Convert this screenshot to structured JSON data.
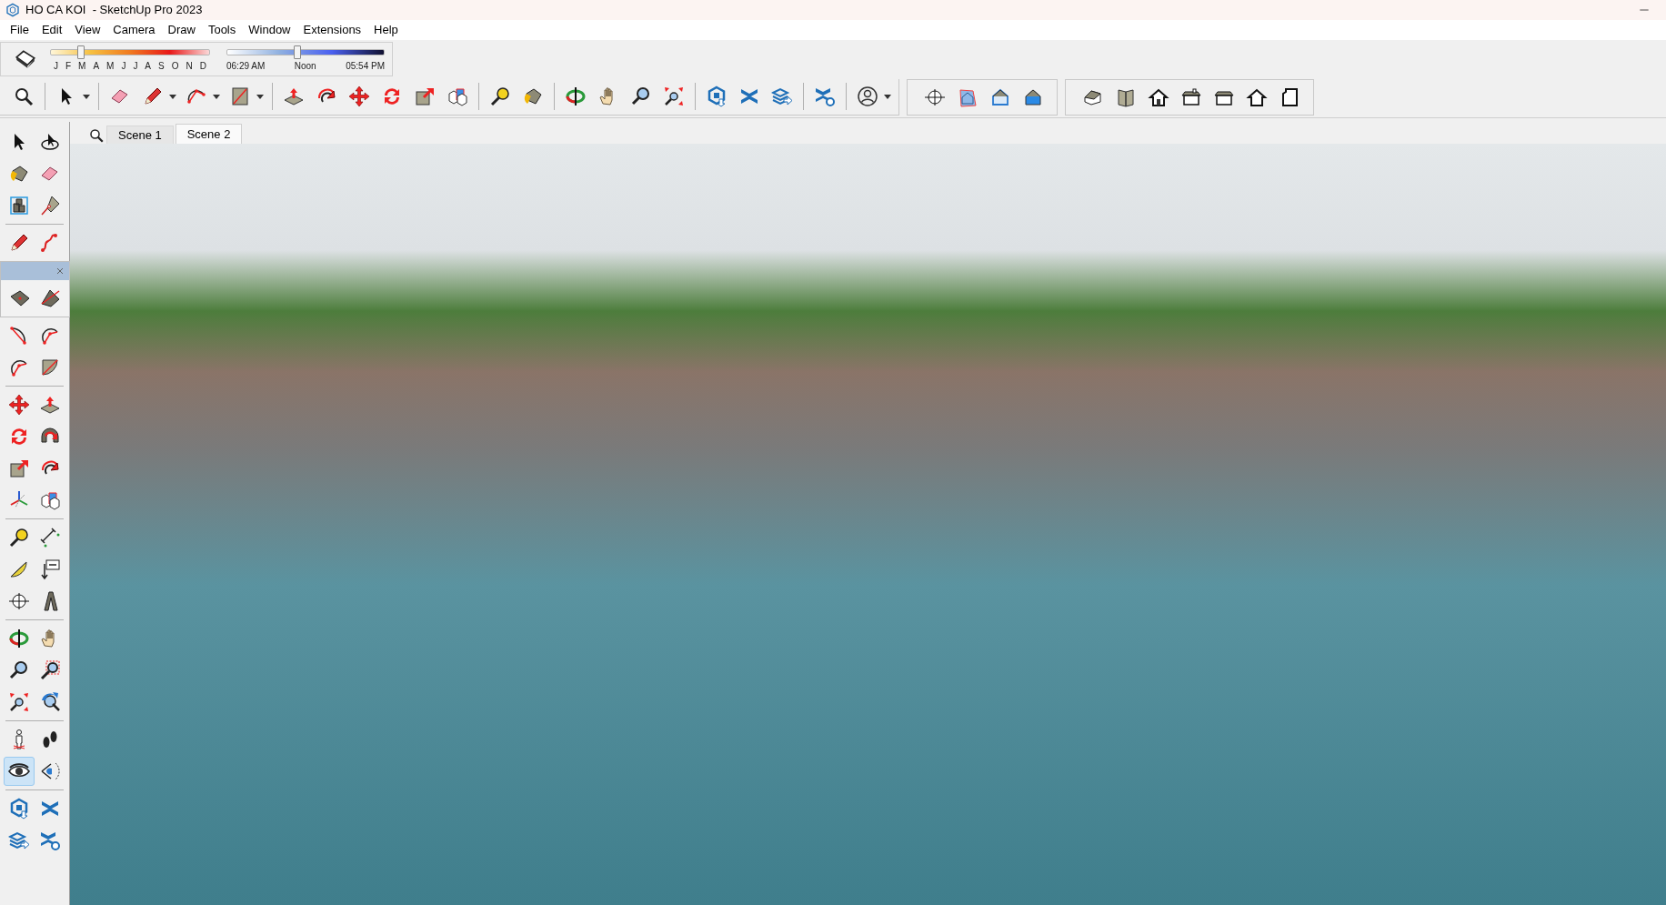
{
  "window": {
    "title": "HO CA KOI  - SketchUp Pro 2023"
  },
  "menu_bar": [
    "File",
    "Edit",
    "View",
    "Camera",
    "Draw",
    "Tools",
    "Window",
    "Extensions",
    "Help"
  ],
  "shadow_toolbar": {
    "months": [
      "J",
      "F",
      "M",
      "A",
      "M",
      "J",
      "J",
      "A",
      "S",
      "O",
      "N",
      "D"
    ],
    "date_slider": {
      "level": 0.19
    },
    "time_slider": {
      "level": 0.45
    },
    "time_labels": [
      "06:29 AM",
      "Noon",
      "05:54 PM"
    ]
  },
  "scene_tabs": [
    {
      "label": "Scene 1",
      "selected": false
    },
    {
      "label": "Scene 2",
      "selected": true
    }
  ],
  "left_toolbar": {
    "tools": [
      {
        "selected": false
      },
      {
        "selected": false
      },
      {
        "selected": false
      },
      {
        "selected": false
      },
      {
        "selected": false
      },
      {
        "selected": false
      },
      {
        "selected": false
      },
      {
        "selected": false
      },
      {
        "selected": false
      },
      {
        "selected": false
      },
      {
        "selected": false
      },
      {
        "selected": false
      },
      {
        "selected": false
      },
      {
        "selected": false
      },
      {
        "selected": false
      },
      {
        "selected": false
      },
      {
        "selected": false
      },
      {
        "selected": false
      },
      {
        "selected": false
      },
      {
        "selected": false
      },
      {
        "selected": false
      },
      {
        "selected": false
      },
      {
        "selected": false
      },
      {
        "selected": false
      },
      {
        "selected": false
      },
      {
        "selected": false
      },
      {
        "selected": false
      },
      {
        "selected": false
      },
      {
        "selected": false
      },
      {
        "selected": false
      },
      {
        "selected": false
      },
      {
        "selected": false
      },
      {
        "selected": false
      },
      {
        "selected": false
      },
      {
        "selected": true
      },
      {
        "selected": false
      },
      {
        "selected": false
      },
      {
        "selected": false
      },
      {
        "selected": false
      },
      {
        "selected": false
      }
    ]
  }
}
